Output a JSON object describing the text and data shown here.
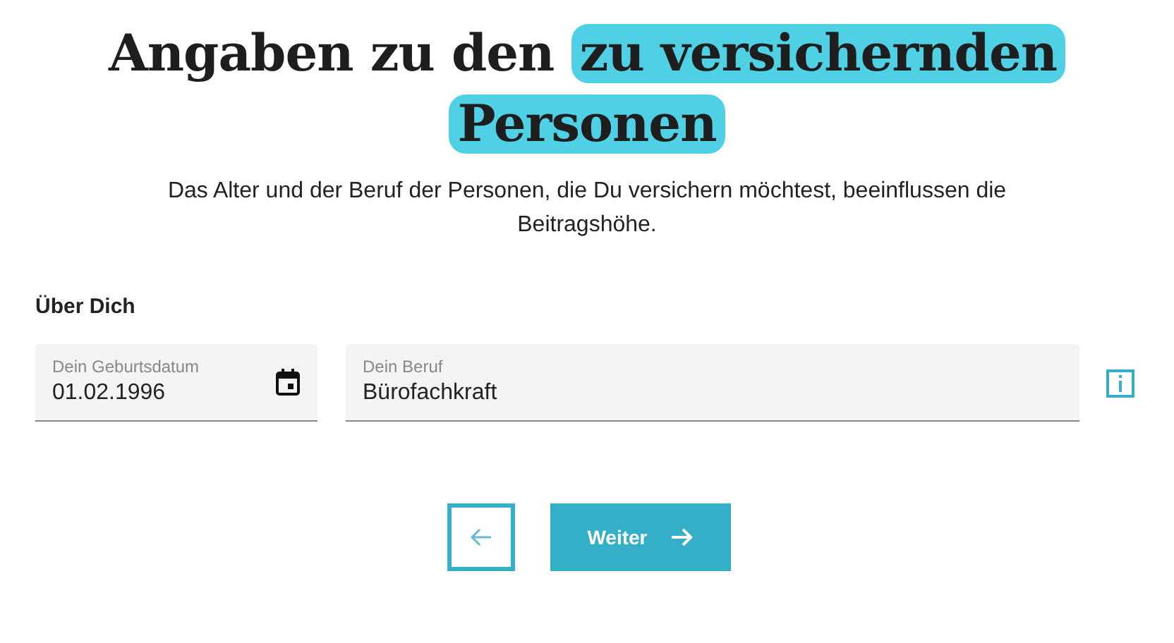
{
  "title": {
    "text": "Angaben zu den",
    "highlight": "zu versichernden Personen"
  },
  "subtitle": "Das Alter und der Beruf der Personen, die Du versichern möchtest, beeinflussen die Beitragshöhe.",
  "section": "Über Dich",
  "fields": [
    {
      "kind": "date",
      "label": "Dein Geburtsdatum",
      "value": "01.02.1996"
    },
    {
      "kind": "text",
      "label": "Dein Beruf",
      "value": "Bürofachkraft"
    }
  ],
  "next_button": "Weiter"
}
